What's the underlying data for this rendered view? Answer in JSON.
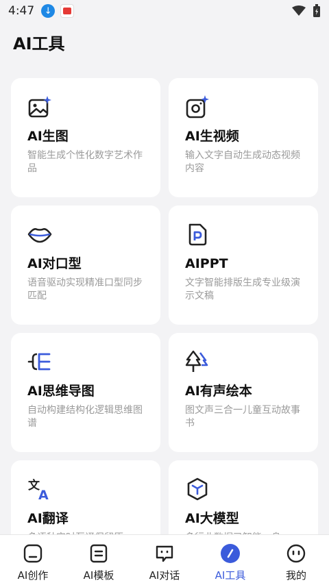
{
  "status": {
    "time": "4:47"
  },
  "header": {
    "title": "AI工具"
  },
  "tools": [
    {
      "title": "AI生图",
      "desc": "智能生成个性化数字艺术作品",
      "icon": "image-sparkle-icon"
    },
    {
      "title": "AI生视频",
      "desc": "输入文字自动生成动态视频内容",
      "icon": "video-sparkle-icon"
    },
    {
      "title": "AI对口型",
      "desc": "语音驱动实现精准口型同步匹配",
      "icon": "lips-icon"
    },
    {
      "title": "AIPPT",
      "desc": "文字智能排版生成专业级演示文稿",
      "icon": "ppt-file-icon"
    },
    {
      "title": "AI思维导图",
      "desc": "自动构建结构化逻辑思维图谱",
      "icon": "mindmap-icon"
    },
    {
      "title": "AI有声绘本",
      "desc": "图文声三合一儿童互动故事书",
      "icon": "tree-icon"
    },
    {
      "title": "AI翻译",
      "desc": "多语种实时互译保留原",
      "icon": "translate-icon"
    },
    {
      "title": "AI大模型",
      "desc": "多行业数据已智能一身",
      "icon": "cube-icon"
    }
  ],
  "tabbar": [
    {
      "label": "AI创作",
      "icon": "create-icon"
    },
    {
      "label": "AI模板",
      "icon": "template-icon"
    },
    {
      "label": "AI对话",
      "icon": "chat-icon"
    },
    {
      "label": "AI工具",
      "icon": "tools-icon",
      "active": true
    },
    {
      "label": "我的",
      "icon": "profile-icon"
    }
  ],
  "colors": {
    "accent": "#3b5bdb",
    "text": "#111111",
    "muted": "#9a9a9a"
  }
}
